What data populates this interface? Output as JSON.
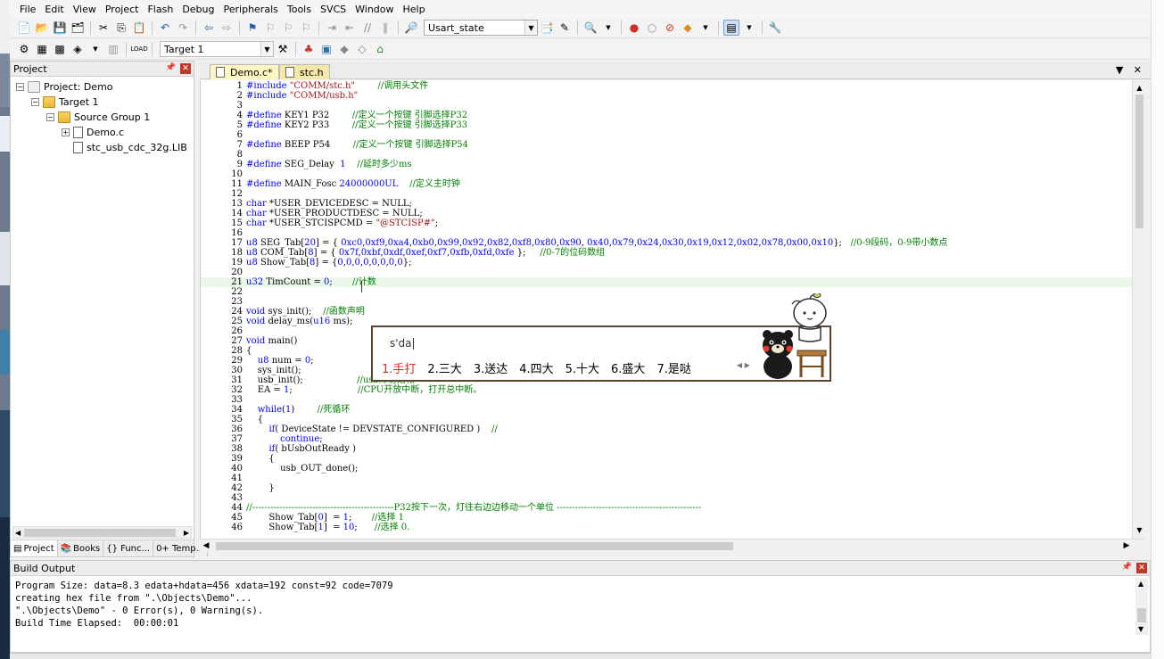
{
  "menu": [
    "File",
    "Edit",
    "View",
    "Project",
    "Flash",
    "Debug",
    "Peripherals",
    "Tools",
    "SVCS",
    "Window",
    "Help"
  ],
  "toolbar": {
    "target_combo": "Usart_state",
    "target_name": "Target 1"
  },
  "project_panel": {
    "title": "Project",
    "tree": [
      {
        "label": "Project: Demo",
        "level": 0,
        "expander": "−",
        "icon": "project-icon"
      },
      {
        "label": "Target 1",
        "level": 1,
        "expander": "−",
        "icon": "target-icon"
      },
      {
        "label": "Source Group 1",
        "level": 2,
        "expander": "−",
        "icon": "folder-icon"
      },
      {
        "label": "Demo.c",
        "level": 3,
        "expander": "+",
        "icon": "file-icon"
      },
      {
        "label": "stc_usb_cdc_32g.LIB",
        "level": 3,
        "expander": "",
        "icon": "file-icon"
      }
    ],
    "tabs": [
      "Project",
      "Books",
      "{} Func...",
      "0+ Temp..."
    ]
  },
  "editor": {
    "tabs": [
      "Demo.c*",
      "stc.h"
    ],
    "lines": [
      {
        "n": "1",
        "t": "#include \"COMM/stc.h\"        //调用头文件"
      },
      {
        "n": "2",
        "t": "#include \"COMM/usb.h\""
      },
      {
        "n": "3",
        "t": ""
      },
      {
        "n": "4",
        "t": "#define KEY1 P32        //定义一个按键 引脚选择P32"
      },
      {
        "n": "5",
        "t": "#define KEY2 P33        //定义一个按键 引脚选择P33"
      },
      {
        "n": "6",
        "t": ""
      },
      {
        "n": "7",
        "t": "#define BEEP P54        //定义一个按键 引脚选择P54"
      },
      {
        "n": "8",
        "t": ""
      },
      {
        "n": "9",
        "t": "#define SEG_Delay  1    //延时多少ms"
      },
      {
        "n": "10",
        "t": ""
      },
      {
        "n": "11",
        "t": "#define MAIN_Fosc 24000000UL    //定义主时钟"
      },
      {
        "n": "12",
        "t": ""
      },
      {
        "n": "13",
        "t": "char *USER_DEVICEDESC = NULL;"
      },
      {
        "n": "14",
        "t": "char *USER_PRODUCTDESC = NULL;"
      },
      {
        "n": "15",
        "t": "char *USER_STCISPCMD = \"@STCISP#\";"
      },
      {
        "n": "16",
        "t": ""
      },
      {
        "n": "17",
        "t": "u8 SEG_Tab[20] = { 0xc0,0xf9,0xa4,0xb0,0x99,0x92,0x82,0xf8,0x80,0x90, 0x40,0x79,0x24,0x30,0x19,0x12,0x02,0x78,0x00,0x10};   //0-9段码，0-9带小数点"
      },
      {
        "n": "18",
        "t": "u8 COM_Tab[8] = { 0x7f,0xbf,0xdf,0xef,0xf7,0xfb,0xfd,0xfe };     //0-7的位码数组"
      },
      {
        "n": "19",
        "t": "u8 Show_Tab[8] = {0,0,0,0,0,0,0,0};"
      },
      {
        "n": "20",
        "t": ""
      },
      {
        "n": "21",
        "t": "u32 TimCount = 0;       //计数"
      },
      {
        "n": "22",
        "t": ""
      },
      {
        "n": "23",
        "t": ""
      },
      {
        "n": "24",
        "t": "void sys_init();    //函数声明"
      },
      {
        "n": "25",
        "t": "void delay_ms(u16 ms);"
      },
      {
        "n": "26",
        "t": ""
      },
      {
        "n": "27",
        "t": "void main()"
      },
      {
        "n": "28",
        "t": "{"
      },
      {
        "n": "29",
        "t": "    u8 num = 0;"
      },
      {
        "n": "30",
        "t": "    sys_init();"
      },
      {
        "n": "31",
        "t": "    usb_init();                   //usb库初始化"
      },
      {
        "n": "32",
        "t": "    EA = 1;                       //CPU开放中断，打开总中断。"
      },
      {
        "n": "33",
        "t": ""
      },
      {
        "n": "34",
        "t": "    while(1)        //死循环"
      },
      {
        "n": "35",
        "t": "    {"
      },
      {
        "n": "36",
        "t": "        if( DeviceState != DEVSTATE_CONFIGURED )    //"
      },
      {
        "n": "37",
        "t": "            continue;"
      },
      {
        "n": "38",
        "t": "        if( bUsbOutReady )"
      },
      {
        "n": "39",
        "t": "        {"
      },
      {
        "n": "40",
        "t": "            usb_OUT_done();"
      },
      {
        "n": "41",
        "t": ""
      },
      {
        "n": "42",
        "t": "        }"
      },
      {
        "n": "43",
        "t": ""
      },
      {
        "n": "44",
        "t": "//-----------------------------------------------P32按下一次，灯往右边边移动一个单位 ------------------------------------------------"
      },
      {
        "n": "45",
        "t": "        Show_Tab[0]  = 1;       //选择 1"
      },
      {
        "n": "46",
        "t": "        Show_Tab[1]  = 10;      //选择 0."
      }
    ]
  },
  "ime": {
    "input": "s'da",
    "candidates": [
      "1.手打",
      "2.三大",
      "3.送达",
      "4.四大",
      "5.十大",
      "6.盛大",
      "7.是哒"
    ]
  },
  "build_output": {
    "title": "Build Output",
    "lines": [
      "Program Size: data=8.3 edata+hdata=456 xdata=192 const=92 code=7079",
      "creating hex file from \".\\Objects\\Demo\"...",
      "\".\\Objects\\Demo\" - 0 Error(s), 0 Warning(s).",
      "Build Time Elapsed:  00:00:01"
    ]
  }
}
